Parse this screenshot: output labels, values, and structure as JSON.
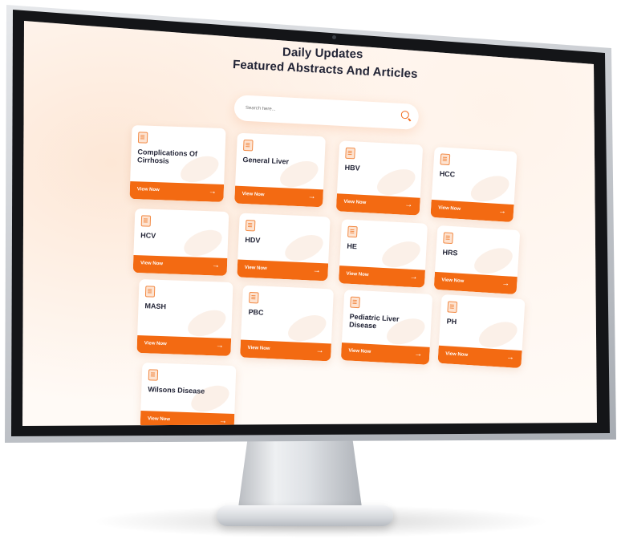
{
  "header": {
    "line1": "Daily Updates",
    "line2": "Featured Abstracts And Articles"
  },
  "search": {
    "placeholder": "Search here..."
  },
  "cta_label": "View Now",
  "cards": [
    {
      "title": "Complications Of Cirrhosis"
    },
    {
      "title": "General Liver"
    },
    {
      "title": "HBV"
    },
    {
      "title": "HCC"
    },
    {
      "title": "HCV"
    },
    {
      "title": "HDV"
    },
    {
      "title": "HE"
    },
    {
      "title": "HRS"
    },
    {
      "title": "MASH"
    },
    {
      "title": "PBC"
    },
    {
      "title": "Pediatric Liver Disease"
    },
    {
      "title": "PH"
    },
    {
      "title": "Wilsons Disease"
    }
  ],
  "colors": {
    "accent": "#f36a12",
    "title_text": "#222436",
    "bezel": "#141518"
  },
  "icons": {
    "card_icon": "document-icon",
    "cta_icon": "arrow-right-icon",
    "search_icon": "search-icon"
  }
}
